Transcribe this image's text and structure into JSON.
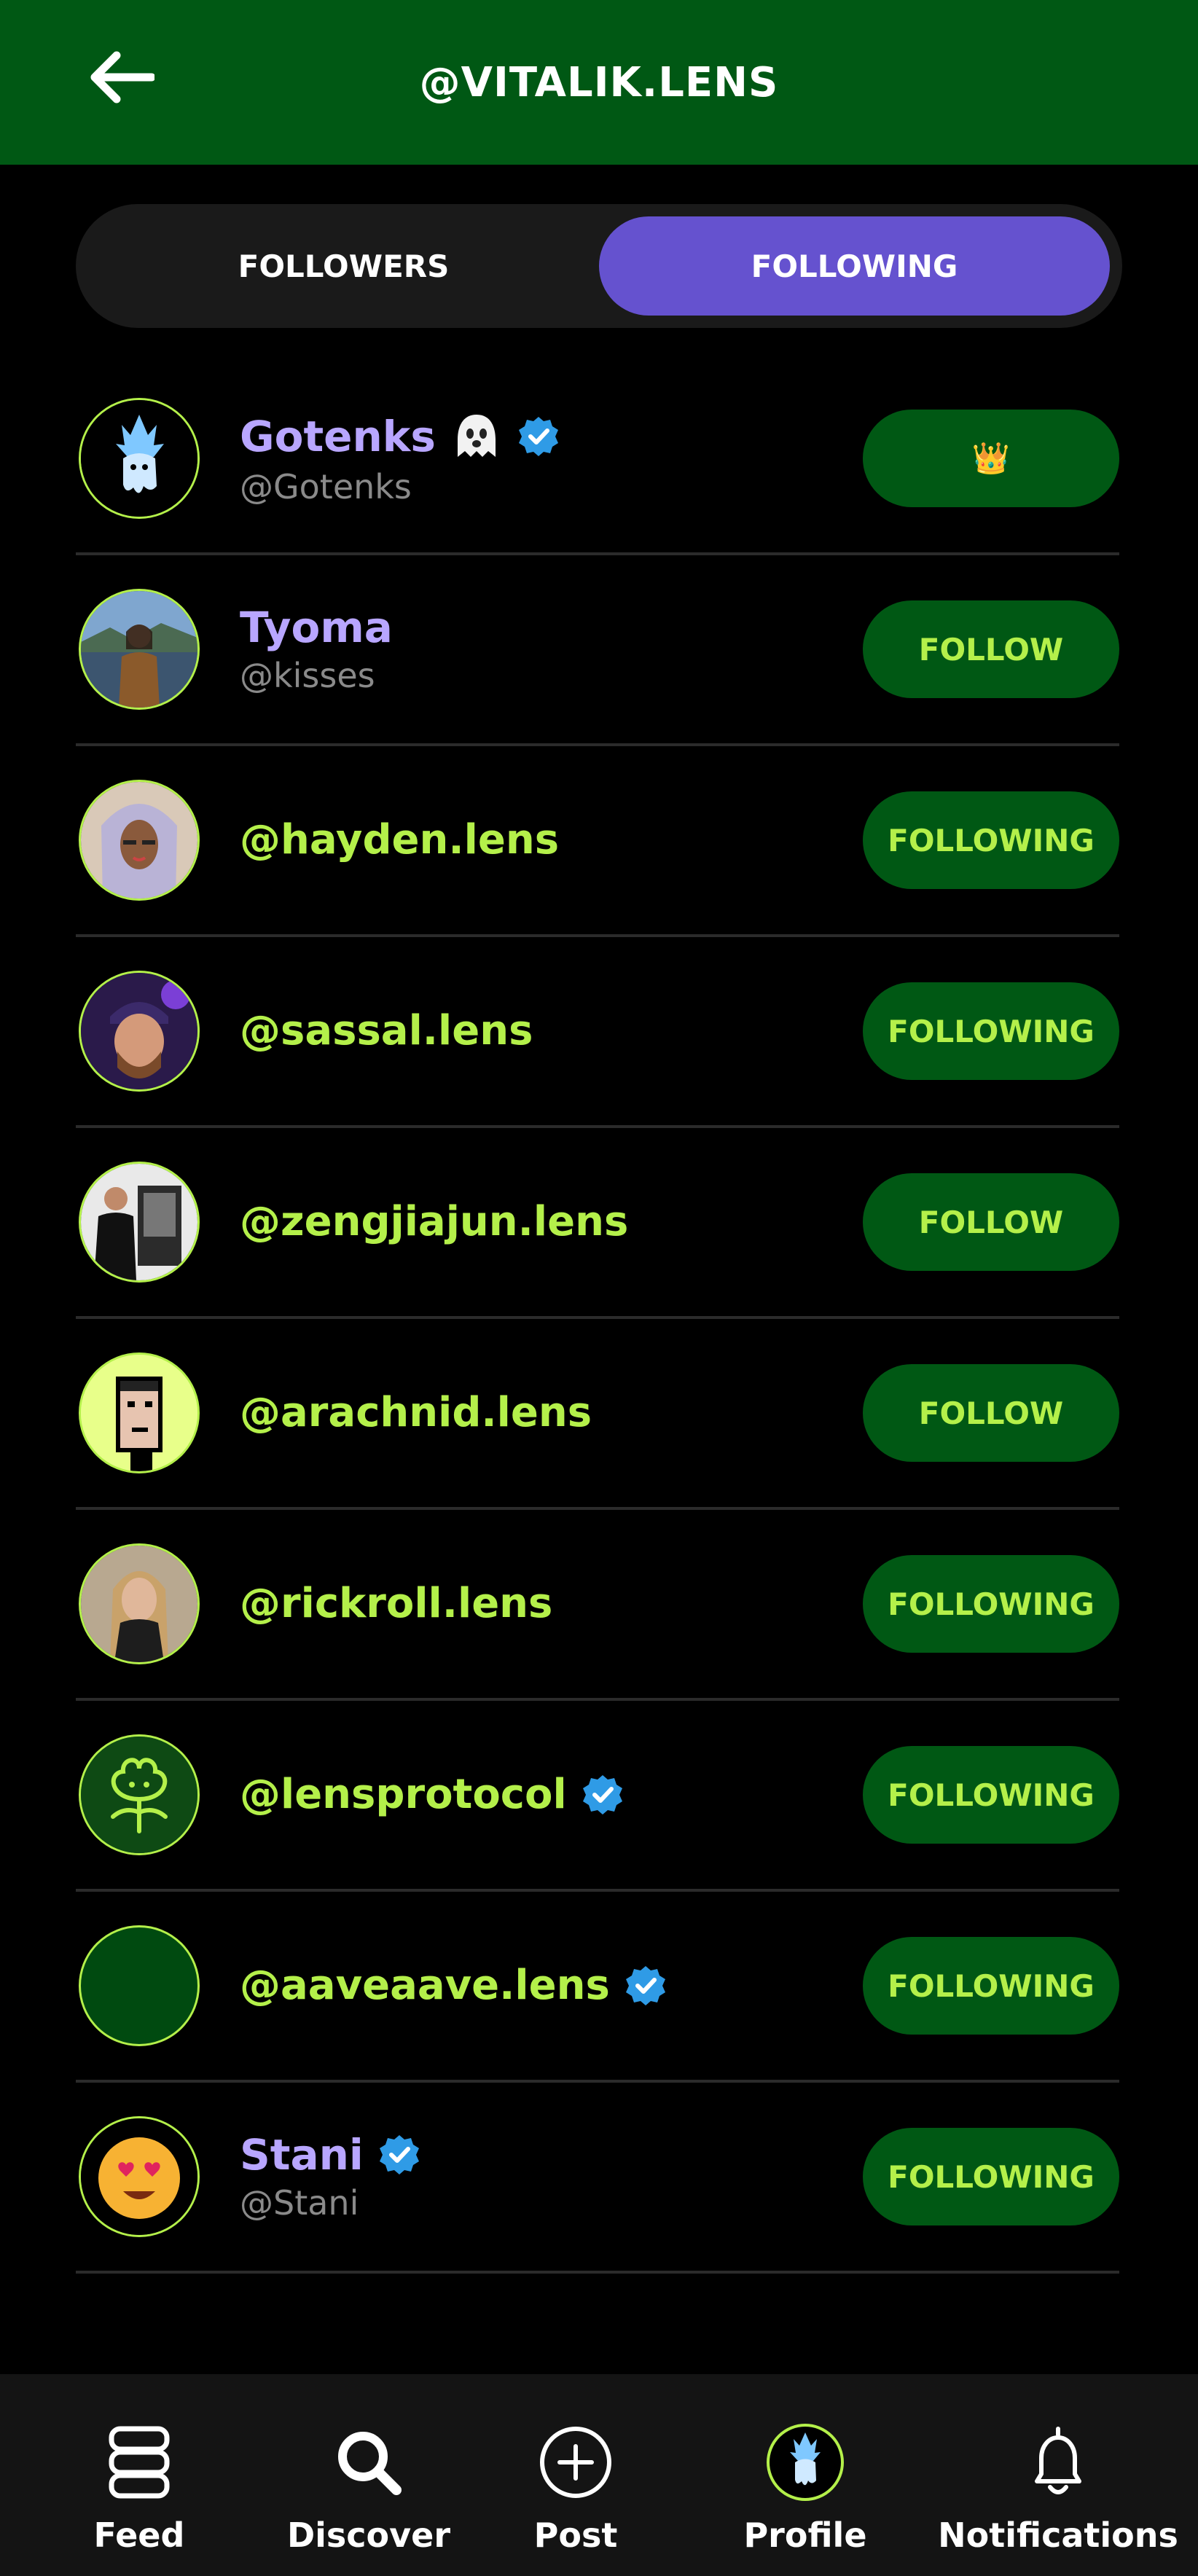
{
  "header": {
    "title": "@VITALIK.LENS",
    "back_icon": "arrow-left-icon"
  },
  "tabs": [
    {
      "label": "FOLLOWERS",
      "active": false
    },
    {
      "label": "FOLLOWING",
      "active": true
    }
  ],
  "users": [
    {
      "name": "Gotenks",
      "handle": "@Gotenks",
      "emoji": "ghost",
      "verified": true,
      "action": "👑"
    },
    {
      "name": "Tyoma",
      "handle": "@kisses",
      "verified": false,
      "action": "FOLLOW"
    },
    {
      "name": "@hayden.lens",
      "verified": false,
      "action": "FOLLOWING"
    },
    {
      "name": "@sassal.lens",
      "verified": false,
      "action": "FOLLOWING"
    },
    {
      "name": "@zengjiajun.lens",
      "verified": false,
      "action": "FOLLOW"
    },
    {
      "name": "@arachnid.lens",
      "verified": false,
      "action": "FOLLOW"
    },
    {
      "name": "@rickroll.lens",
      "verified": false,
      "action": "FOLLOWING"
    },
    {
      "name": "@lensprotocol",
      "verified": true,
      "action": "FOLLOWING"
    },
    {
      "name": "@aaveaave.lens",
      "verified": true,
      "action": "FOLLOWING"
    },
    {
      "name": "Stani",
      "handle": "@Stani",
      "verified": true,
      "action": "FOLLOWING"
    }
  ],
  "nav": [
    {
      "label": "Feed",
      "icon": "feed-stack-icon"
    },
    {
      "label": "Discover",
      "icon": "search-icon"
    },
    {
      "label": "Post",
      "icon": "plus-circle-icon"
    },
    {
      "label": "Profile",
      "icon": "profile-avatar-icon"
    },
    {
      "label": "Notifications",
      "icon": "bell-icon"
    }
  ],
  "colors": {
    "header_bg": "#005814",
    "accent_green": "#b4f04a",
    "active_tab": "#6552cf",
    "name_purple": "#b8a6ff",
    "verified_blue": "#2f9be6"
  }
}
